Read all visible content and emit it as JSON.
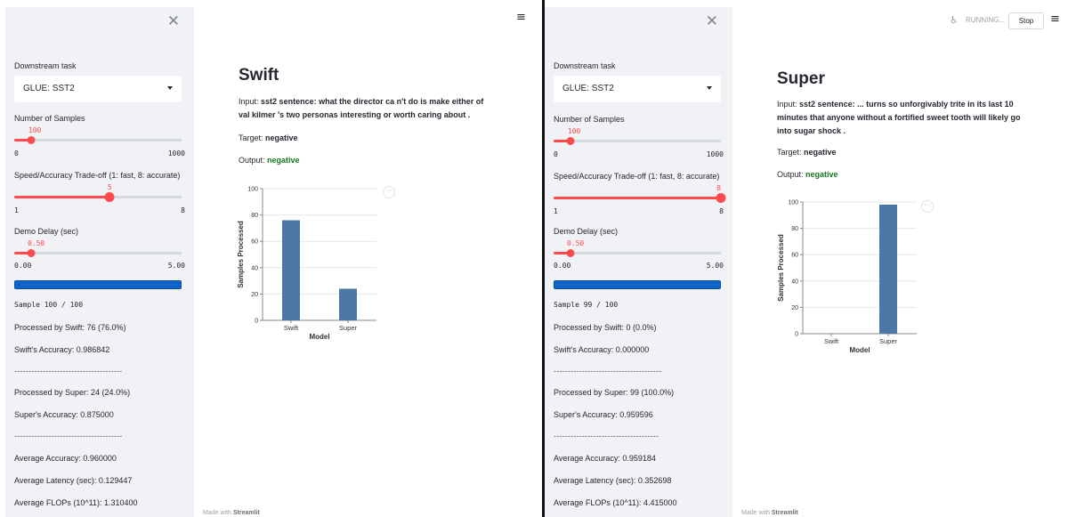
{
  "left": {
    "sidebar": {
      "close_glyph": "✕",
      "downstream_label": "Downstream task",
      "task_value": "GLUE: SST2",
      "samples_label": "Number of Samples",
      "samples_value": "100",
      "samples_min": "0",
      "samples_max": "1000",
      "samples_fraction": 0.1,
      "tradeoff_label": "Speed/Accuracy Trade-off (1: fast, 8: accurate)",
      "tradeoff_value": "5",
      "tradeoff_min": "1",
      "tradeoff_max": "8",
      "tradeoff_fraction": 0.571,
      "delay_label": "Demo Delay (sec)",
      "delay_value": "0.50",
      "delay_min": "0.00",
      "delay_max": "5.00",
      "delay_fraction": 0.1,
      "progress_fraction": 1.0,
      "sample_text": "Sample 100 / 100",
      "processed_swift": "Processed by Swift: 76 (76.0%)",
      "swift_accuracy": "Swift's Accuracy: 0.986842",
      "dashes1": "--------------------------------------",
      "processed_super": "Processed by Super: 24 (24.0%)",
      "super_accuracy": "Super's Accuracy: 0.875000",
      "dashes2": "--------------------------------------",
      "avg_accuracy": "Average Accuracy: 0.960000",
      "avg_latency": "Average Latency (sec): 0.129447",
      "avg_flops": "Average FLOPs (10^11): 1.310400"
    },
    "main": {
      "menu_glyph": "≡",
      "title": "Swift",
      "input_label": "Input:",
      "input_text": "sst2 sentence: what the director ca n't do is make either of val kilmer 's two personas interesting or worth caring about .",
      "target_label": "Target:",
      "target_value": "negative",
      "output_label": "Output:",
      "output_value": "negative",
      "more_glyph": "···",
      "made_with": "Made with ",
      "made_brand": "Streamlit"
    }
  },
  "right": {
    "header": {
      "status_text": "RUNNING...",
      "run_glyph": "♿",
      "stop_label": "Stop",
      "menu_glyph": "≡"
    },
    "sidebar": {
      "close_glyph": "✕",
      "downstream_label": "Downstream task",
      "task_value": "GLUE: SST2",
      "samples_label": "Number of Samples",
      "samples_value": "100",
      "samples_min": "0",
      "samples_max": "1000",
      "samples_fraction": 0.1,
      "tradeoff_label": "Speed/Accuracy Trade-off (1: fast, 8: accurate)",
      "tradeoff_value": "8",
      "tradeoff_min": "1",
      "tradeoff_max": "8",
      "tradeoff_fraction": 1.0,
      "delay_label": "Demo Delay (sec)",
      "delay_value": "0.50",
      "delay_min": "0.00",
      "delay_max": "5.00",
      "delay_fraction": 0.1,
      "progress_fraction": 1.0,
      "sample_text": "Sample 99 / 100",
      "processed_swift": "Processed by Swift: 0 (0.0%)",
      "swift_accuracy": "Swift's Accuracy: 0.000000",
      "dashes1": "--------------------------------------",
      "processed_super": "Processed by Super: 99 (100.0%)",
      "super_accuracy": "Super's Accuracy: 0.959596",
      "dashes2": "-------------------------------------",
      "avg_accuracy": "Average Accuracy: 0.959184",
      "avg_latency": "Average Latency (sec): 0.352698",
      "avg_flops": "Average FLOPs (10^11): 4.415000"
    },
    "main": {
      "title": "Super",
      "input_label": "Input:",
      "input_text": "sst2 sentence: ... turns so unforgivably trite in its last 10 minutes that anyone without a fortified sweet tooth will likely go into sugar shock .",
      "target_label": "Target:",
      "target_value": "negative",
      "output_label": "Output:",
      "output_value": "negative",
      "more_glyph": "···",
      "made_with": "Made with ",
      "made_brand": "Streamlit"
    }
  },
  "chart_data": [
    {
      "type": "bar",
      "categories": [
        "Swift",
        "Super"
      ],
      "values": [
        76,
        24
      ],
      "xlabel": "Model",
      "ylabel": "Samples Processed",
      "ylim": [
        0,
        100
      ],
      "yticks": [
        0,
        20,
        40,
        60,
        80,
        100
      ],
      "bar_color": "#4c78a8"
    },
    {
      "type": "bar",
      "categories": [
        "Swift",
        "Super"
      ],
      "values": [
        0,
        98
      ],
      "xlabel": "Model",
      "ylabel": "Samples Processed",
      "ylim": [
        0,
        100
      ],
      "yticks": [
        0,
        20,
        40,
        60,
        80,
        100
      ],
      "bar_color": "#4c78a8"
    }
  ],
  "colors": {
    "accent": "#ff4b4b",
    "progress": "#0e63c9",
    "sidebar_bg": "#f0f2f6",
    "output_green": "#157a21"
  }
}
